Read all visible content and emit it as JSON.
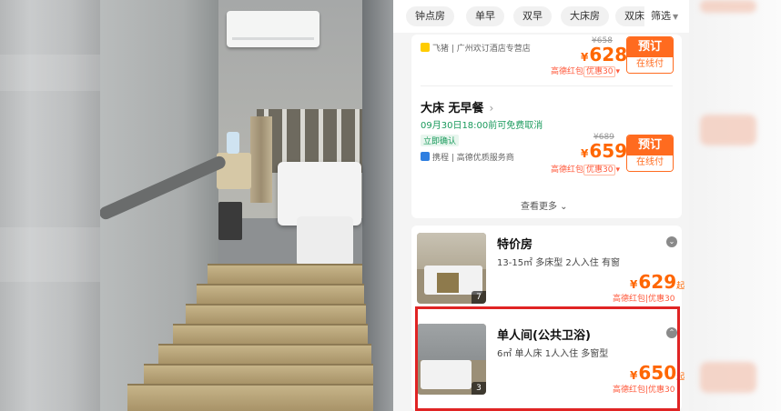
{
  "filter_bar": {
    "chips": [
      "钟点房",
      "单早",
      "双早",
      "大床房",
      "双床"
    ],
    "filter_label": "筛选"
  },
  "offer1": {
    "supplier": "飞猪 | 广州欢订酒店专营店",
    "original_price": "¥658",
    "currency": "¥",
    "price": "628",
    "promo_text": "高德红包",
    "promo_box": "优惠30",
    "book_label": "预订",
    "pay_label": "在线付"
  },
  "offer2": {
    "room_title": "大床 无早餐",
    "cancel_policy": "09月30日18:00前可免费取消",
    "confirm_tag": "立即确认",
    "supplier": "携程 | 高德优质服务商",
    "original_price": "¥689",
    "currency": "¥",
    "price": "659",
    "promo_text": "高德红包",
    "promo_box": "优惠30",
    "book_label": "预订",
    "pay_label": "在线付"
  },
  "see_more": "查看更多",
  "rooms": [
    {
      "name": "特价房",
      "desc": "13-15㎡  多床型  2人入住  有窗",
      "photo_count": "7",
      "currency": "¥",
      "price": "629",
      "price_suffix": "起",
      "promo": "高德红包|优惠30"
    },
    {
      "name": "单人间(公共卫浴)",
      "desc": "6㎡  单人床  1人入住  多窗型",
      "photo_count": "3",
      "currency": "¥",
      "price": "650",
      "price_suffix": "起",
      "promo": "高德红包|优惠30"
    }
  ],
  "colors": {
    "accent": "#ff6b1f",
    "price": "#ff6600",
    "green": "#1a9a5c",
    "highlight": "#e02424"
  }
}
